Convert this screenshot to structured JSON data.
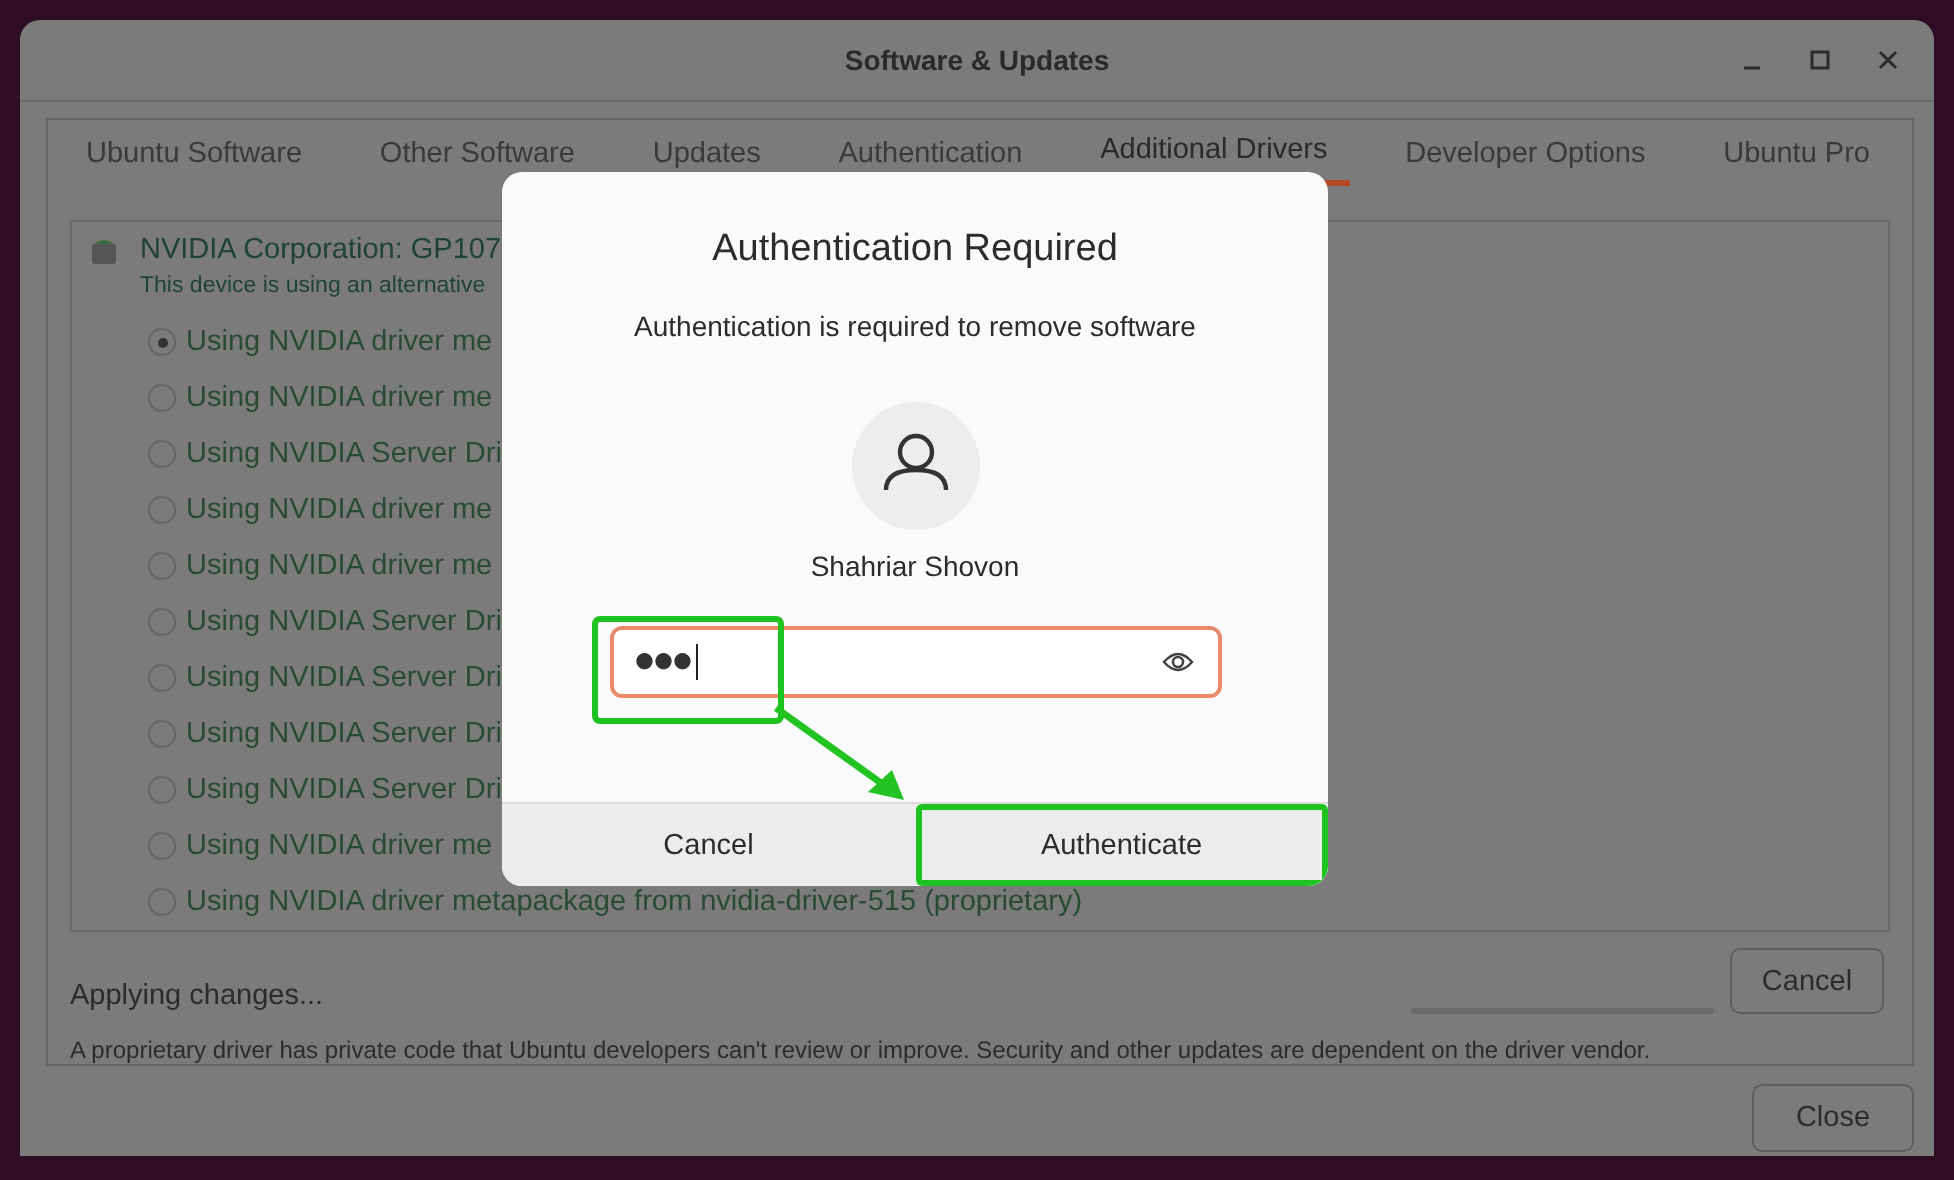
{
  "window": {
    "title": "Software & Updates"
  },
  "tabs": [
    {
      "label": "Ubuntu Software",
      "selected": false
    },
    {
      "label": "Other Software",
      "selected": false
    },
    {
      "label": "Updates",
      "selected": false
    },
    {
      "label": "Authentication",
      "selected": false
    },
    {
      "label": "Additional Drivers",
      "selected": true
    },
    {
      "label": "Developer Options",
      "selected": false
    },
    {
      "label": "Ubuntu Pro",
      "selected": false
    }
  ],
  "device": {
    "name": "NVIDIA Corporation: GP107",
    "description": "This device is using an alternative"
  },
  "drivers": [
    {
      "label": "Using NVIDIA driver me",
      "selected": true
    },
    {
      "label": "Using NVIDIA driver me",
      "selected": false
    },
    {
      "label": "Using NVIDIA Server Dri",
      "selected": false
    },
    {
      "label": "Using NVIDIA driver me",
      "selected": false
    },
    {
      "label": "Using NVIDIA driver me",
      "selected": false
    },
    {
      "label": "Using NVIDIA Server Dri",
      "selected": false
    },
    {
      "label": "Using NVIDIA Server Dri",
      "selected": false
    },
    {
      "label": "Using NVIDIA Server Dri",
      "selected": false
    },
    {
      "label": "Using NVIDIA Server Dri",
      "selected": false
    },
    {
      "label": "Using NVIDIA driver me",
      "selected": false
    },
    {
      "label": "Using NVIDIA driver metapackage from nvidia-driver-515 (proprietary)",
      "selected": false
    }
  ],
  "status": "Applying changes...",
  "progress": {
    "level": 0
  },
  "cancel_button": "Cancel",
  "note": "A proprietary driver has private code that Ubuntu developers can't review or improve. Security and other updates are dependent on the driver vendor.",
  "close_button": "Close",
  "dialog": {
    "title": "Authentication Required",
    "message": "Authentication is required to remove software",
    "user": "Shahriar Shovon",
    "password": {
      "value": "●●●",
      "highlighted": true
    },
    "buttons": [
      {
        "label": "Cancel",
        "highlighted": false
      },
      {
        "label": "Authenticate",
        "highlighted": true
      }
    ]
  }
}
